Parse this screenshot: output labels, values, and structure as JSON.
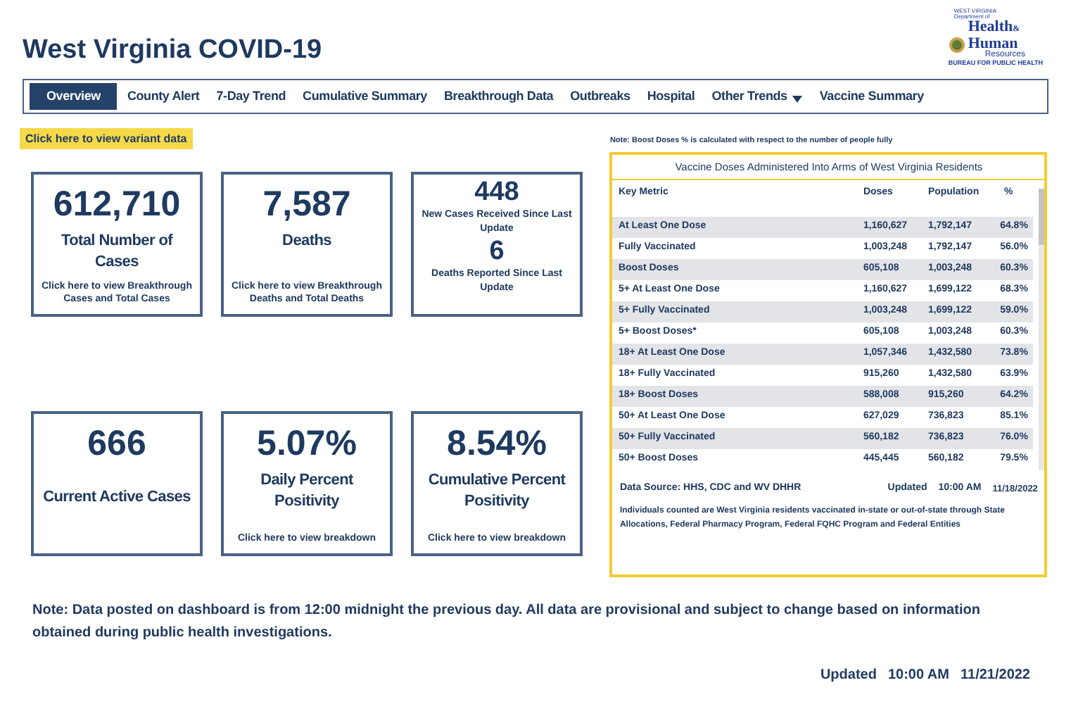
{
  "title": "West Virginia COVID-19",
  "logo": {
    "state": "WEST VIRGINIA",
    "dept": "Department of",
    "line1": "Health",
    "amp": "&",
    "line2": "Human",
    "line3": "Resources",
    "bureau": "BUREAU FOR PUBLIC HEALTH"
  },
  "nav": [
    {
      "label": "Overview",
      "selected": true
    },
    {
      "label": "County Alert",
      "selected": false
    },
    {
      "label": "7-Day Trend",
      "selected": false
    },
    {
      "label": "Cumulative Summary",
      "selected": false
    },
    {
      "label": "Breakthrough Data",
      "selected": false
    },
    {
      "label": "Outbreaks",
      "selected": false
    },
    {
      "label": "Hospital",
      "selected": false
    },
    {
      "label": "Other Trends",
      "selected": false,
      "dropdown": true
    },
    {
      "label": "Vaccine Summary",
      "selected": false
    }
  ],
  "variant_button": "Click here to view variant data",
  "cards": [
    {
      "kind": "stat",
      "value": "612,710",
      "label": "Total Number of Cases",
      "link": "Click here to view Breakthrough Cases and Total Cases"
    },
    {
      "kind": "stat",
      "value": "7,587",
      "label": "Deaths",
      "link": "Click here to view Breakthrough Deaths and Total Deaths"
    },
    {
      "kind": "double",
      "value": "448",
      "label": "New Cases Received Since Last Update",
      "value2": "6",
      "label2": "Deaths Reported Since Last Update"
    },
    {
      "kind": "stat",
      "value": "666",
      "label": "Current Active Cases"
    },
    {
      "kind": "stat",
      "value": "5.07%",
      "label": "Daily Percent Positivity",
      "link": "Click here to view breakdown"
    },
    {
      "kind": "stat",
      "value": "8.54%",
      "label": "Cumulative Percent Positivity",
      "link": "Click here to view breakdown"
    }
  ],
  "vaccine": {
    "note": "Note: Boost Doses % is calculated with respect to the number of people fully",
    "title": "Vaccine Doses Administered Into Arms of West Virginia Residents",
    "columns": [
      "Key Metric",
      "Doses",
      "Population",
      "%"
    ],
    "rows": [
      [
        "At Least One Dose",
        "1,160,627",
        "1,792,147",
        "64.8%"
      ],
      [
        "Fully Vaccinated",
        "1,003,248",
        "1,792,147",
        "56.0%"
      ],
      [
        "Boost Doses",
        "605,108",
        "1,003,248",
        "60.3%"
      ],
      [
        "5+ At Least One Dose",
        "1,160,627",
        "1,699,122",
        "68.3%"
      ],
      [
        "5+ Fully Vaccinated",
        "1,003,248",
        "1,699,122",
        "59.0%"
      ],
      [
        "5+ Boost Doses*",
        "605,108",
        "1,003,248",
        "60.3%"
      ],
      [
        "18+ At Least One Dose",
        "1,057,346",
        "1,432,580",
        "73.8%"
      ],
      [
        "18+ Fully Vaccinated",
        "915,260",
        "1,432,580",
        "63.9%"
      ],
      [
        "18+ Boost Doses",
        "588,008",
        "915,260",
        "64.2%"
      ],
      [
        "50+ At Least One Dose",
        "627,029",
        "736,823",
        "85.1%"
      ],
      [
        "50+ Fully Vaccinated",
        "560,182",
        "736,823",
        "76.0%"
      ],
      [
        "50+ Boost Doses",
        "445,445",
        "560,182",
        "79.5%"
      ]
    ],
    "source": "Data Source: HHS, CDC and WV DHHR",
    "updated_label": "Updated",
    "updated_time": "10:00 AM",
    "updated_date": "11/18/2022",
    "footnote": "Individuals counted are West Virginia residents vaccinated in-state or out-of-state through State Allocations, Federal Pharmacy Program, Federal FQHC Program and Federal Entities"
  },
  "note": "Note: Data posted on dashboard is from 12:00 midnight the previous day. All data are provisional and subject to change based on information obtained during public health investigations.",
  "updated": {
    "label": "Updated",
    "time": "10:00 AM",
    "date": "11/21/2022"
  }
}
